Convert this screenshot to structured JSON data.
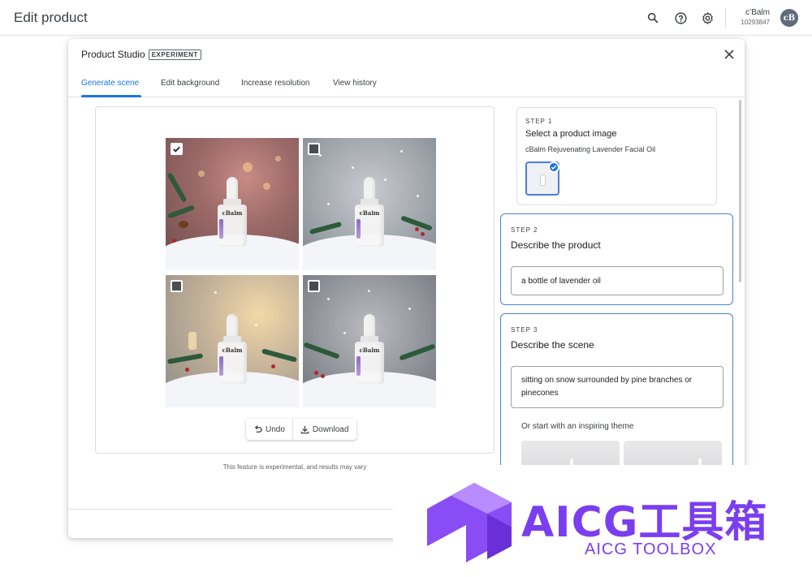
{
  "topbar": {
    "title": "Edit product",
    "account_name": "c’Balm",
    "account_number": "10293847",
    "avatar_initials": "cB"
  },
  "dialog": {
    "title": "Product Studio",
    "badge": "EXPERIMENT",
    "tabs": [
      {
        "label": "Generate scene",
        "active": true
      },
      {
        "label": "Edit background",
        "active": false
      },
      {
        "label": "Increase resolution",
        "active": false
      },
      {
        "label": "View history",
        "active": false
      }
    ]
  },
  "preview": {
    "images": [
      {
        "selected": true,
        "brand_label": "cBalm"
      },
      {
        "selected": false,
        "brand_label": "cBalm"
      },
      {
        "selected": false,
        "brand_label": "cBalm"
      },
      {
        "selected": false,
        "brand_label": "cBalm"
      }
    ],
    "undo_label": "Undo",
    "download_label": "Download",
    "disclaimer": "This feature is experimental, and results may vary"
  },
  "steps": {
    "step1": {
      "number": "STEP 1",
      "title": "Select a product image",
      "product": "cBalm Rejuvenating Lavender Facial Oil"
    },
    "step2": {
      "number": "STEP 2",
      "title": "Describe the product",
      "value": "a bottle of lavender oil"
    },
    "step3": {
      "number": "STEP 3",
      "title": "Describe the scene",
      "value": "sitting on snow surrounded by pine branches or pinecones",
      "theme_label": "Or start with an inspiring theme"
    }
  },
  "watermark": {
    "text": "AICG工具箱",
    "sub": "AICG TOOLBOX"
  },
  "colors": {
    "accent": "#1a73e8",
    "step_border": "#4a7fe0",
    "watermark": "#7a3ef0"
  }
}
